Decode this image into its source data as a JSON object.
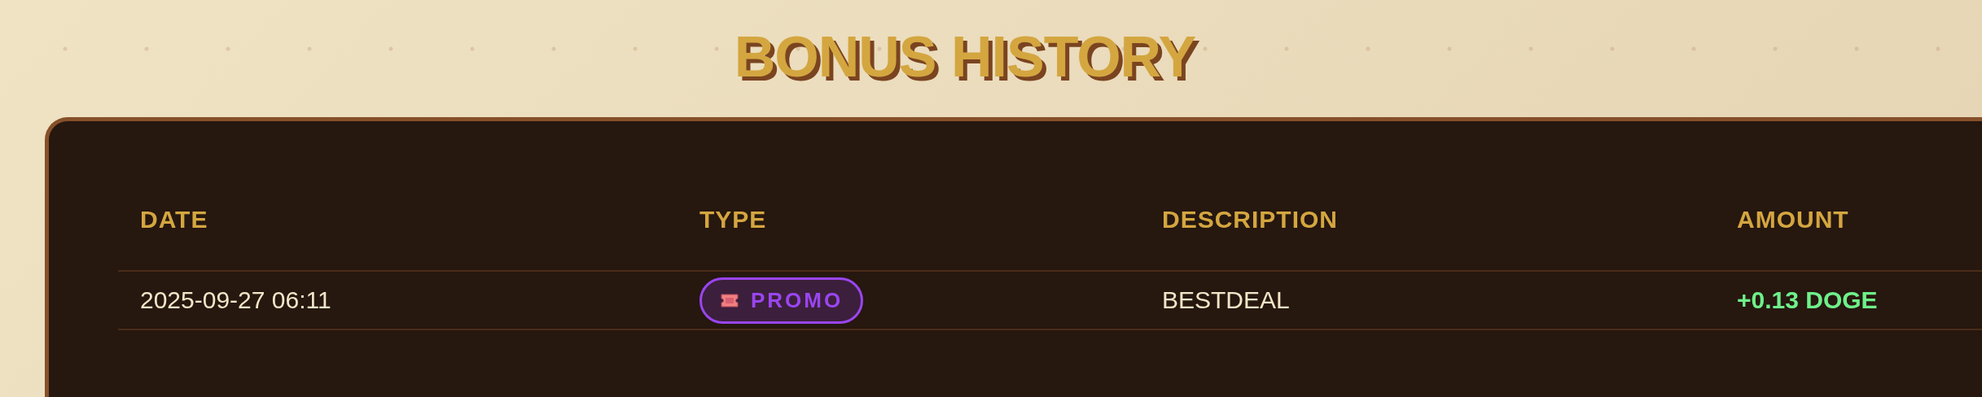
{
  "title": "BONUS HISTORY",
  "table": {
    "columns": [
      "DATE",
      "TYPE",
      "DESCRIPTION",
      "AMOUNT"
    ],
    "rows": [
      {
        "date": "2025-09-27 06:11",
        "type": {
          "kind": "promo",
          "label": "PROMO"
        },
        "description": "BESTDEAL",
        "amount": "+0.13 DOGE"
      }
    ]
  }
}
